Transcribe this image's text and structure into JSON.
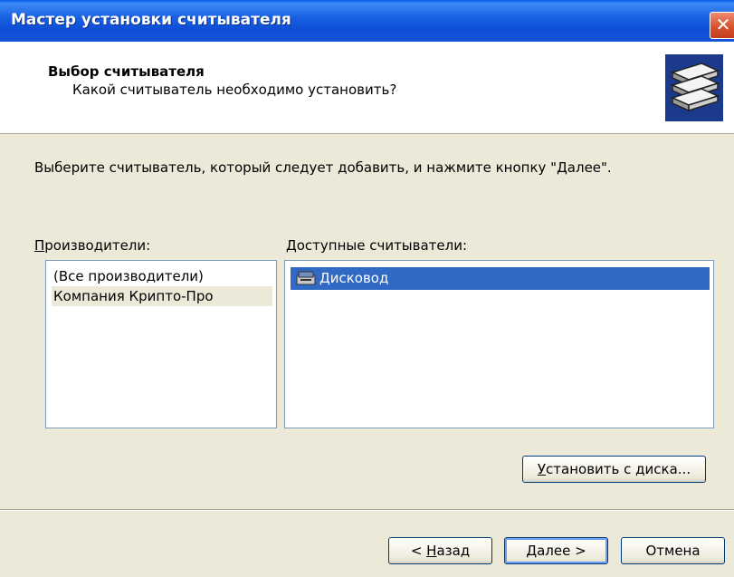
{
  "window": {
    "title": "Мастер установки считывателя",
    "close_glyph": "✕"
  },
  "header": {
    "title": "Выбор считывателя",
    "subtitle": "Какой считыватель необходимо установить?",
    "icon": "card-reader-stack-icon"
  },
  "instruction": "Выберите считыватель, который следует добавить, и нажмите кнопку \"Далее\".",
  "manufacturers": {
    "label_accel": "П",
    "label_rest": "роизводители:",
    "items": [
      "(Все производители)",
      "Компания Крипто-Про"
    ],
    "selected_index": 1
  },
  "readers": {
    "label_accel": "Д",
    "label_rest": "оступные считыватели:",
    "items": [
      {
        "label": "Дисковод",
        "icon": "floppy-drive-icon",
        "selected": true
      }
    ]
  },
  "buttons": {
    "install_accel": "У",
    "install_rest": "становить с диска...",
    "back_prefix": "< ",
    "back_accel": "Н",
    "back_rest": "азад",
    "next_accel": "Д",
    "next_rest": "алее >",
    "cancel": "Отмена"
  },
  "colors": {
    "titlebar": "#1a62e2",
    "selection": "#316ac5",
    "dialog_bg": "#ece9d8"
  }
}
